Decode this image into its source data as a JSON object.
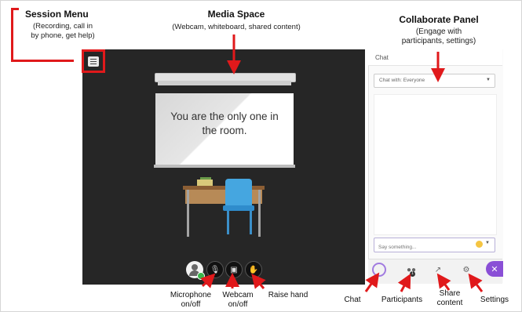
{
  "annotations": {
    "session_menu": {
      "title": "Session Menu",
      "desc_line1": "(Recording, call in",
      "desc_line2": "by phone, get help)"
    },
    "media_space": {
      "title": "Media Space",
      "desc": "(Webcam, whiteboard, shared content)"
    },
    "collaborate_panel": {
      "title": "Collaborate Panel",
      "desc_line1": "(Engage with",
      "desc_line2": "participants, settings)"
    }
  },
  "media": {
    "screen_text_line1": "You are the only one in",
    "screen_text_line2": "the room."
  },
  "panel": {
    "title": "Chat",
    "chat_with": "Chat with: Everyone",
    "input_placeholder": "Say something..."
  },
  "labels": {
    "microphone_1": "Microphone",
    "microphone_2": "on/off",
    "webcam_1": "Webcam",
    "webcam_2": "on/off",
    "raise_hand": "Raise hand",
    "chat": "Chat",
    "participants": "Participants",
    "share_1": "Share",
    "share_2": "content",
    "settings": "Settings"
  },
  "colors": {
    "annotation_red": "#e0191b",
    "media_background": "#262626",
    "accent_purple": "#8a4fd6"
  },
  "icons": [
    "menu-icon",
    "microphone-icon",
    "webcam-icon",
    "raise-hand-icon",
    "chat-icon",
    "participants-icon",
    "share-content-icon",
    "settings-icon",
    "close-icon",
    "emoji-icon",
    "chevron-down-icon"
  ],
  "participants_badge": "1"
}
